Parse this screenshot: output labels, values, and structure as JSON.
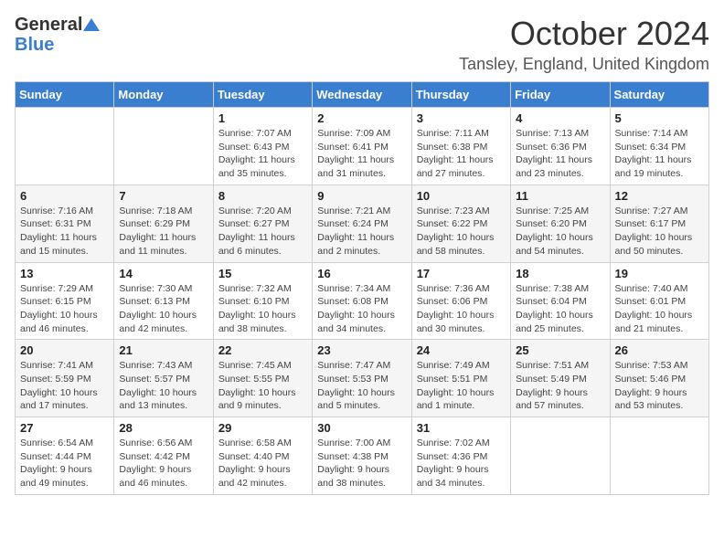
{
  "header": {
    "logo_general": "General",
    "logo_blue": "Blue",
    "month": "October 2024",
    "location": "Tansley, England, United Kingdom"
  },
  "weekdays": [
    "Sunday",
    "Monday",
    "Tuesday",
    "Wednesday",
    "Thursday",
    "Friday",
    "Saturday"
  ],
  "weeks": [
    [
      {
        "day": "",
        "info": ""
      },
      {
        "day": "",
        "info": ""
      },
      {
        "day": "1",
        "info": "Sunrise: 7:07 AM\nSunset: 6:43 PM\nDaylight: 11 hours and 35 minutes."
      },
      {
        "day": "2",
        "info": "Sunrise: 7:09 AM\nSunset: 6:41 PM\nDaylight: 11 hours and 31 minutes."
      },
      {
        "day": "3",
        "info": "Sunrise: 7:11 AM\nSunset: 6:38 PM\nDaylight: 11 hours and 27 minutes."
      },
      {
        "day": "4",
        "info": "Sunrise: 7:13 AM\nSunset: 6:36 PM\nDaylight: 11 hours and 23 minutes."
      },
      {
        "day": "5",
        "info": "Sunrise: 7:14 AM\nSunset: 6:34 PM\nDaylight: 11 hours and 19 minutes."
      }
    ],
    [
      {
        "day": "6",
        "info": "Sunrise: 7:16 AM\nSunset: 6:31 PM\nDaylight: 11 hours and 15 minutes."
      },
      {
        "day": "7",
        "info": "Sunrise: 7:18 AM\nSunset: 6:29 PM\nDaylight: 11 hours and 11 minutes."
      },
      {
        "day": "8",
        "info": "Sunrise: 7:20 AM\nSunset: 6:27 PM\nDaylight: 11 hours and 6 minutes."
      },
      {
        "day": "9",
        "info": "Sunrise: 7:21 AM\nSunset: 6:24 PM\nDaylight: 11 hours and 2 minutes."
      },
      {
        "day": "10",
        "info": "Sunrise: 7:23 AM\nSunset: 6:22 PM\nDaylight: 10 hours and 58 minutes."
      },
      {
        "day": "11",
        "info": "Sunrise: 7:25 AM\nSunset: 6:20 PM\nDaylight: 10 hours and 54 minutes."
      },
      {
        "day": "12",
        "info": "Sunrise: 7:27 AM\nSunset: 6:17 PM\nDaylight: 10 hours and 50 minutes."
      }
    ],
    [
      {
        "day": "13",
        "info": "Sunrise: 7:29 AM\nSunset: 6:15 PM\nDaylight: 10 hours and 46 minutes."
      },
      {
        "day": "14",
        "info": "Sunrise: 7:30 AM\nSunset: 6:13 PM\nDaylight: 10 hours and 42 minutes."
      },
      {
        "day": "15",
        "info": "Sunrise: 7:32 AM\nSunset: 6:10 PM\nDaylight: 10 hours and 38 minutes."
      },
      {
        "day": "16",
        "info": "Sunrise: 7:34 AM\nSunset: 6:08 PM\nDaylight: 10 hours and 34 minutes."
      },
      {
        "day": "17",
        "info": "Sunrise: 7:36 AM\nSunset: 6:06 PM\nDaylight: 10 hours and 30 minutes."
      },
      {
        "day": "18",
        "info": "Sunrise: 7:38 AM\nSunset: 6:04 PM\nDaylight: 10 hours and 25 minutes."
      },
      {
        "day": "19",
        "info": "Sunrise: 7:40 AM\nSunset: 6:01 PM\nDaylight: 10 hours and 21 minutes."
      }
    ],
    [
      {
        "day": "20",
        "info": "Sunrise: 7:41 AM\nSunset: 5:59 PM\nDaylight: 10 hours and 17 minutes."
      },
      {
        "day": "21",
        "info": "Sunrise: 7:43 AM\nSunset: 5:57 PM\nDaylight: 10 hours and 13 minutes."
      },
      {
        "day": "22",
        "info": "Sunrise: 7:45 AM\nSunset: 5:55 PM\nDaylight: 10 hours and 9 minutes."
      },
      {
        "day": "23",
        "info": "Sunrise: 7:47 AM\nSunset: 5:53 PM\nDaylight: 10 hours and 5 minutes."
      },
      {
        "day": "24",
        "info": "Sunrise: 7:49 AM\nSunset: 5:51 PM\nDaylight: 10 hours and 1 minute."
      },
      {
        "day": "25",
        "info": "Sunrise: 7:51 AM\nSunset: 5:49 PM\nDaylight: 9 hours and 57 minutes."
      },
      {
        "day": "26",
        "info": "Sunrise: 7:53 AM\nSunset: 5:46 PM\nDaylight: 9 hours and 53 minutes."
      }
    ],
    [
      {
        "day": "27",
        "info": "Sunrise: 6:54 AM\nSunset: 4:44 PM\nDaylight: 9 hours and 49 minutes."
      },
      {
        "day": "28",
        "info": "Sunrise: 6:56 AM\nSunset: 4:42 PM\nDaylight: 9 hours and 46 minutes."
      },
      {
        "day": "29",
        "info": "Sunrise: 6:58 AM\nSunset: 4:40 PM\nDaylight: 9 hours and 42 minutes."
      },
      {
        "day": "30",
        "info": "Sunrise: 7:00 AM\nSunset: 4:38 PM\nDaylight: 9 hours and 38 minutes."
      },
      {
        "day": "31",
        "info": "Sunrise: 7:02 AM\nSunset: 4:36 PM\nDaylight: 9 hours and 34 minutes."
      },
      {
        "day": "",
        "info": ""
      },
      {
        "day": "",
        "info": ""
      }
    ]
  ]
}
